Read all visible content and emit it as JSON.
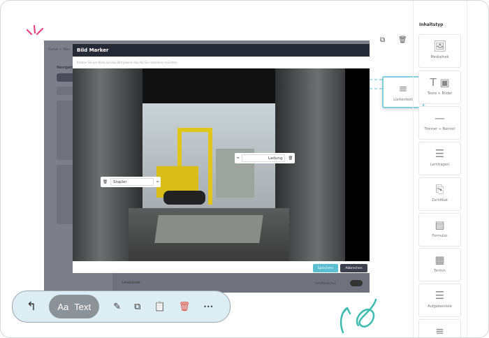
{
  "app": {
    "breadcrumb": "Kurse > Neu",
    "nav_label": "Navigation",
    "toggle_label": "Veröffentlichen",
    "item_label": "Inhaltsblatt"
  },
  "modal": {
    "title": "Bild Marker",
    "subtitle": "Klicken Sie per Klick auf das Bild jeweils das die Sie markieren möchten.",
    "markers": [
      {
        "label": "Stapler"
      },
      {
        "label": "Ladung"
      }
    ],
    "save": "Speichern",
    "cancel": "Abbrechen"
  },
  "drag": {
    "label": "Lückentext"
  },
  "sidebar": {
    "title": "Inhaltstyp",
    "items": [
      {
        "label": "Mediathek",
        "icon": "🖼"
      },
      {
        "label": "Texte + Bilder",
        "icon": "T ▣"
      },
      {
        "label": "Trenner + Banner",
        "icon": "—"
      },
      {
        "label": "Lernfragen",
        "icon": "☰"
      },
      {
        "label": "Zertifikat",
        "icon": "⎘"
      },
      {
        "label": "Formular",
        "icon": "▤"
      },
      {
        "label": "Termin",
        "icon": "▦"
      },
      {
        "label": "Aufgabenliste",
        "icon": "☰"
      },
      {
        "label": "",
        "icon": "≡"
      }
    ]
  },
  "toolbar": {
    "back": "↰",
    "aa": "Aa",
    "text": "Text",
    "edit": "✎",
    "copy": "⧉",
    "paste": "📋",
    "delete": "🗑",
    "more": "•••"
  },
  "colors": {
    "accent": "#5bbfd1",
    "dark": "#262936",
    "teal": "#3cbcb0",
    "pink": "#e8457a"
  }
}
